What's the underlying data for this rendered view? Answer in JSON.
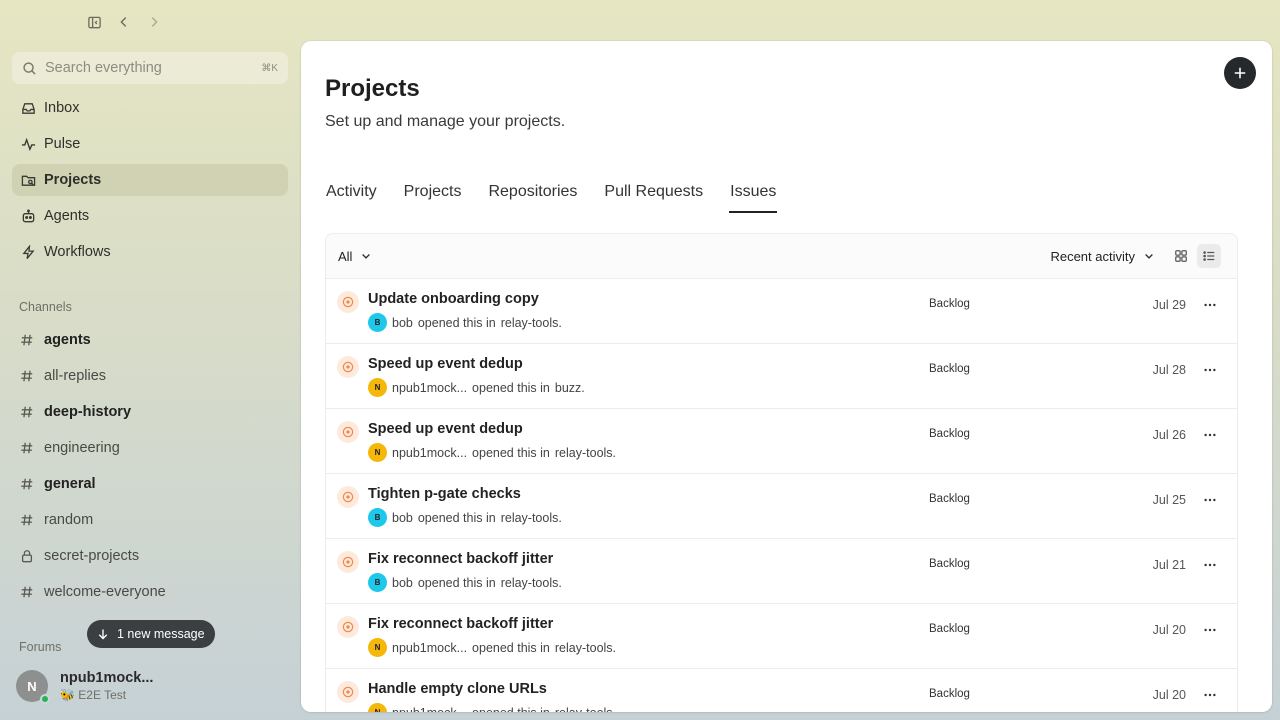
{
  "search": {
    "placeholder": "Search everything",
    "shortcut": "⌘K"
  },
  "nav": [
    {
      "label": "Inbox",
      "icon": "inbox-icon",
      "active": false
    },
    {
      "label": "Pulse",
      "icon": "pulse-icon",
      "active": false
    },
    {
      "label": "Projects",
      "icon": "folder-icon",
      "active": true
    },
    {
      "label": "Agents",
      "icon": "bot-icon",
      "active": false
    },
    {
      "label": "Workflows",
      "icon": "bolt-icon",
      "active": false
    }
  ],
  "channels_label": "Channels",
  "channels": [
    {
      "name": "agents",
      "icon": "hash-icon",
      "unread": true
    },
    {
      "name": "all-replies",
      "icon": "hash-icon",
      "unread": false
    },
    {
      "name": "deep-history",
      "icon": "hash-icon",
      "unread": true
    },
    {
      "name": "engineering",
      "icon": "hash-icon",
      "unread": false
    },
    {
      "name": "general",
      "icon": "hash-icon",
      "unread": true
    },
    {
      "name": "random",
      "icon": "hash-icon",
      "unread": false
    },
    {
      "name": "secret-projects",
      "icon": "lock-icon",
      "unread": false
    },
    {
      "name": "welcome-everyone",
      "icon": "hash-icon",
      "unread": false
    }
  ],
  "forums_label": "Forums",
  "new_message": "1 new message",
  "user": {
    "initial": "N",
    "name": "npub1mock...",
    "status": "🐝 E2E Test"
  },
  "page": {
    "title": "Projects",
    "subtitle": "Set up and manage your projects.",
    "tabs": [
      "Activity",
      "Projects",
      "Repositories",
      "Pull Requests",
      "Issues"
    ],
    "active_tab": 4
  },
  "list": {
    "filter": "All",
    "sort": "Recent activity",
    "rows": [
      {
        "title": "Update onboarding copy",
        "author": "bob",
        "avatar": "B",
        "avatar_color": "#1ec8ea",
        "repo": "relay-tools.",
        "state": "Backlog",
        "date": "Jul 29"
      },
      {
        "title": "Speed up event dedup",
        "author": "npub1mock...",
        "avatar": "N",
        "avatar_color": "#f5b70a",
        "repo": "buzz.",
        "state": "Backlog",
        "date": "Jul 28"
      },
      {
        "title": "Speed up event dedup",
        "author": "npub1mock...",
        "avatar": "N",
        "avatar_color": "#f5b70a",
        "repo": "relay-tools.",
        "state": "Backlog",
        "date": "Jul 26"
      },
      {
        "title": "Tighten p-gate checks",
        "author": "bob",
        "avatar": "B",
        "avatar_color": "#1ec8ea",
        "repo": "relay-tools.",
        "state": "Backlog",
        "date": "Jul 25"
      },
      {
        "title": "Fix reconnect backoff jitter",
        "author": "bob",
        "avatar": "B",
        "avatar_color": "#1ec8ea",
        "repo": "relay-tools.",
        "state": "Backlog",
        "date": "Jul 21"
      },
      {
        "title": "Fix reconnect backoff jitter",
        "author": "npub1mock...",
        "avatar": "N",
        "avatar_color": "#f5b70a",
        "repo": "relay-tools.",
        "state": "Backlog",
        "date": "Jul 20"
      },
      {
        "title": "Handle empty clone URLs",
        "author": "npub1mock...",
        "avatar": "N",
        "avatar_color": "#f5b70a",
        "repo": "relay-tools.",
        "state": "Backlog",
        "date": "Jul 20"
      }
    ]
  },
  "colors": {
    "accent": "#26292b",
    "issue_open": "#f08a4b",
    "online": "#22b35c"
  },
  "phrases": {
    "opened_in": "opened this in"
  }
}
